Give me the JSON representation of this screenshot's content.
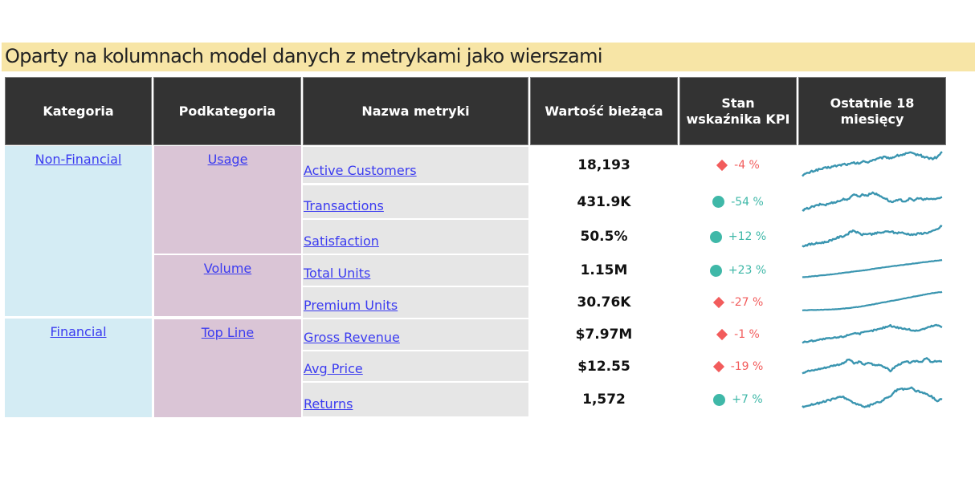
{
  "title": "Oparty na kolumnach model danych z metrykami jako wierszami",
  "headers": {
    "category": "Kategoria",
    "subcategory": "Podkategoria",
    "metric_name": "Nazwa metryki",
    "current_value": "Wartość bieżąca",
    "kpi_status": "Stan wskaźnika KPI",
    "last_18_months": "Ostatnie 18 miesięcy"
  },
  "colors": {
    "header_bg": "#333333",
    "category_bg": "#d4ecf4",
    "subcategory_bg": "#dac5d6",
    "metric_bg": "#e6e6e6",
    "link": "#3b3bf0",
    "good": "#3fb8a8",
    "bad": "#f25c5c",
    "sparkline": "#3a95b0",
    "title_bg": "#f7e5a6"
  },
  "categories": [
    {
      "label": "Non-Financial"
    },
    {
      "label": "Financial"
    }
  ],
  "subcategories": [
    {
      "label": "Usage",
      "category": "Non-Financial"
    },
    {
      "label": "Volume",
      "category": "Non-Financial"
    },
    {
      "label": "Top Line",
      "category": "Financial"
    }
  ],
  "rows": [
    {
      "metric": "Active Customers",
      "value": "18,193",
      "kpi": "-4 %",
      "status": "bad",
      "trend": [
        0.05,
        0.12,
        0.2,
        0.26,
        0.3,
        0.34,
        0.38,
        0.42,
        0.45,
        0.5,
        0.48,
        0.55,
        0.52,
        0.6,
        0.58,
        0.66,
        0.7,
        0.75,
        0.78,
        0.74,
        0.82,
        0.86,
        0.9,
        0.95,
        0.9,
        0.88,
        0.8,
        0.75,
        0.72,
        0.78,
        1.0
      ]
    },
    {
      "metric": "Transactions",
      "value": "431.9K",
      "kpi": "-54 %",
      "status": "good",
      "trend": [
        0.05,
        0.15,
        0.22,
        0.28,
        0.35,
        0.32,
        0.4,
        0.45,
        0.5,
        0.6,
        0.55,
        0.85,
        0.7,
        0.8,
        0.75,
        0.9,
        0.8,
        0.7,
        0.6,
        0.45,
        0.5,
        0.55,
        0.48,
        0.6,
        0.52,
        0.65,
        0.55,
        0.6,
        0.58,
        0.62,
        0.65
      ]
    },
    {
      "metric": "Satisfaction",
      "value": "50.5%",
      "kpi": "+12 %",
      "status": "good",
      "trend": [
        0.05,
        0.1,
        0.13,
        0.16,
        0.2,
        0.22,
        0.3,
        0.38,
        0.45,
        0.5,
        0.62,
        0.75,
        0.62,
        0.55,
        0.6,
        0.58,
        0.62,
        0.65,
        0.68,
        0.7,
        0.62,
        0.66,
        0.6,
        0.58,
        0.55,
        0.6,
        0.62,
        0.65,
        0.7,
        0.8,
        0.95
      ]
    },
    {
      "metric": "Total Units",
      "value": "1.15M",
      "kpi": "+23 %",
      "status": "good",
      "trend": [
        0.1,
        0.13,
        0.16,
        0.19,
        0.22,
        0.26,
        0.3,
        0.34,
        0.38,
        0.42,
        0.46,
        0.5,
        0.55,
        0.6,
        0.64,
        0.68,
        0.72,
        0.76,
        0.8,
        0.84,
        0.88,
        0.92,
        0.96,
        1.0
      ]
    },
    {
      "metric": "Premium Units",
      "value": "30.76K",
      "kpi": "-27 %",
      "status": "bad",
      "trend": [
        0.05,
        0.06,
        0.07,
        0.08,
        0.09,
        0.1,
        0.12,
        0.15,
        0.18,
        0.22,
        0.27,
        0.32,
        0.38,
        0.44,
        0.5,
        0.56,
        0.62,
        0.68,
        0.74,
        0.8,
        0.86,
        0.92,
        0.97,
        1.0
      ]
    },
    {
      "metric": "Gross Revenue",
      "value": "$7.97M",
      "kpi": "-1 %",
      "status": "bad",
      "trend": [
        0.05,
        0.1,
        0.14,
        0.18,
        0.22,
        0.25,
        0.28,
        0.32,
        0.36,
        0.45,
        0.55,
        0.5,
        0.58,
        0.62,
        0.7,
        0.75,
        0.85,
        0.92,
        0.85,
        0.8,
        0.75,
        0.7,
        0.65,
        0.72,
        0.8,
        0.9,
        0.95,
        0.85
      ]
    },
    {
      "metric": "Avg Price",
      "value": "$12.55",
      "kpi": "-19 %",
      "status": "bad",
      "trend": [
        0.1,
        0.2,
        0.22,
        0.3,
        0.35,
        0.42,
        0.5,
        0.55,
        0.62,
        0.85,
        0.6,
        0.7,
        0.55,
        0.65,
        0.5,
        0.55,
        0.4,
        0.2,
        0.45,
        0.6,
        0.7,
        0.65,
        0.75,
        0.7,
        0.9,
        0.65,
        0.75,
        0.7
      ]
    },
    {
      "metric": "Returns",
      "value": "1,572",
      "kpi": "+7 %",
      "status": "good",
      "trend": [
        0.15,
        0.2,
        0.25,
        0.3,
        0.35,
        0.42,
        0.5,
        0.55,
        0.58,
        0.45,
        0.3,
        0.25,
        0.1,
        0.2,
        0.3,
        0.35,
        0.5,
        0.6,
        0.85,
        0.95,
        0.9,
        1.0,
        0.85,
        0.8,
        0.7,
        0.6,
        0.4,
        0.5
      ]
    }
  ]
}
